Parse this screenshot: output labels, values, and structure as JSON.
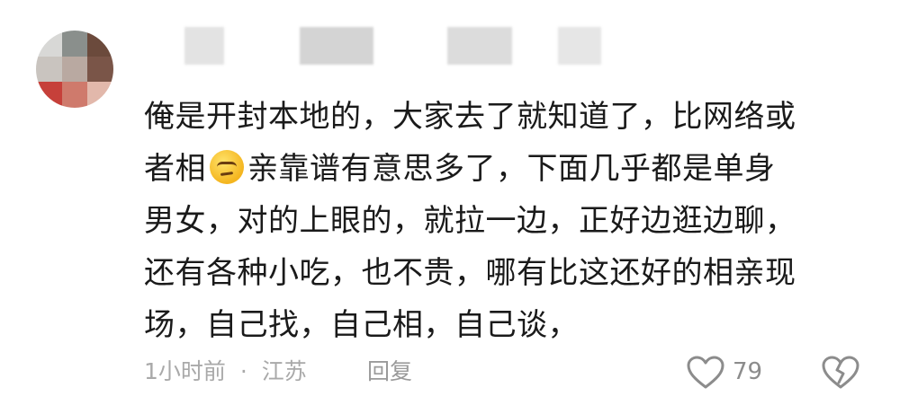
{
  "comment": {
    "lines": [
      "俺是开封本地的，大家去了就知道了，比网络或",
      "者相",
      "亲靠谱有意思多了，下面几乎都是单身",
      "男女，对的上眼的，就拉一边，正好边逛边聊，",
      "还有各种小吃，也不贵，哪有比这还好的相亲现",
      "场，自己找，自己相，自己谈，"
    ],
    "emoji_icon": "smirk-emoji-icon"
  },
  "footer": {
    "time": "1小时前",
    "separator": "·",
    "location": "江苏",
    "reply_label": "回复",
    "like_count": "79",
    "like_icon": "heart-outline-icon",
    "dislike_icon": "broken-heart-icon"
  }
}
